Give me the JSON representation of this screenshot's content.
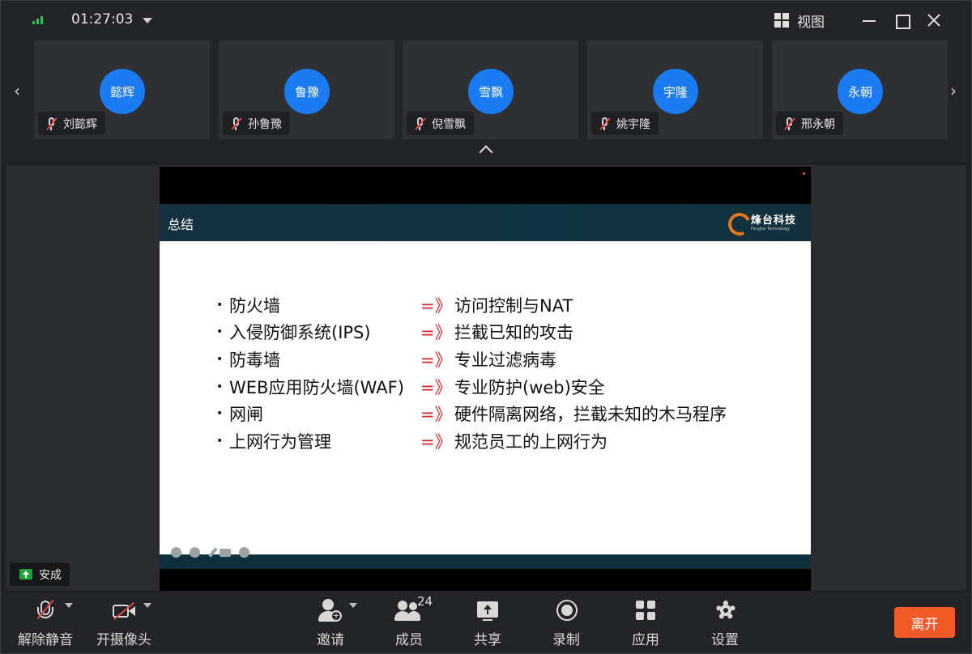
{
  "titlebar": {
    "call_duration": "01:27:03",
    "view_label": "视图"
  },
  "participants": [
    {
      "avatar_text": "懿辉",
      "name": "刘懿辉"
    },
    {
      "avatar_text": "鲁豫",
      "name": "孙鲁豫"
    },
    {
      "avatar_text": "雪飘",
      "name": "倪雪飘"
    },
    {
      "avatar_text": "宇隆",
      "name": "姚宇隆"
    },
    {
      "avatar_text": "永朝",
      "name": "邢永朝"
    }
  ],
  "slide": {
    "title": "总结",
    "logo_cn": "烽台科技",
    "logo_en": "Fengtai Technology",
    "rows": [
      {
        "left": "防火墙",
        "arrow": "=》",
        "right": "访问控制与NAT"
      },
      {
        "left": "入侵防御系统(IPS)",
        "arrow": "=》",
        "right": "拦截已知的攻击"
      },
      {
        "left": "防毒墙",
        "arrow": "=》",
        "right": "专业过滤病毒"
      },
      {
        "left": "WEB应用防火墙(WAF)",
        "arrow": "=》",
        "right": "专业防护(web)安全"
      },
      {
        "left": "网闸",
        "arrow": "=》",
        "right": "硬件隔离网络，拦截未知的木马程序"
      },
      {
        "left": "上网行为管理",
        "arrow": "=》",
        "right": "规范员工的上网行为"
      }
    ],
    "bullet_char": "•"
  },
  "presenter": {
    "name": "安成"
  },
  "toolbar": {
    "unmute": "解除静音",
    "camera": "开摄像头",
    "invite": "邀请",
    "members": "成员",
    "members_count": "24",
    "share": "共享",
    "record": "录制",
    "apps": "应用",
    "settings": "设置",
    "leave": "离开"
  },
  "colors": {
    "avatar": "#1a7cf0",
    "leave": "#f05a26",
    "arrow_red": "#d8232a",
    "signal_green": "#2fbf4a",
    "mute_red": "#e24646"
  }
}
